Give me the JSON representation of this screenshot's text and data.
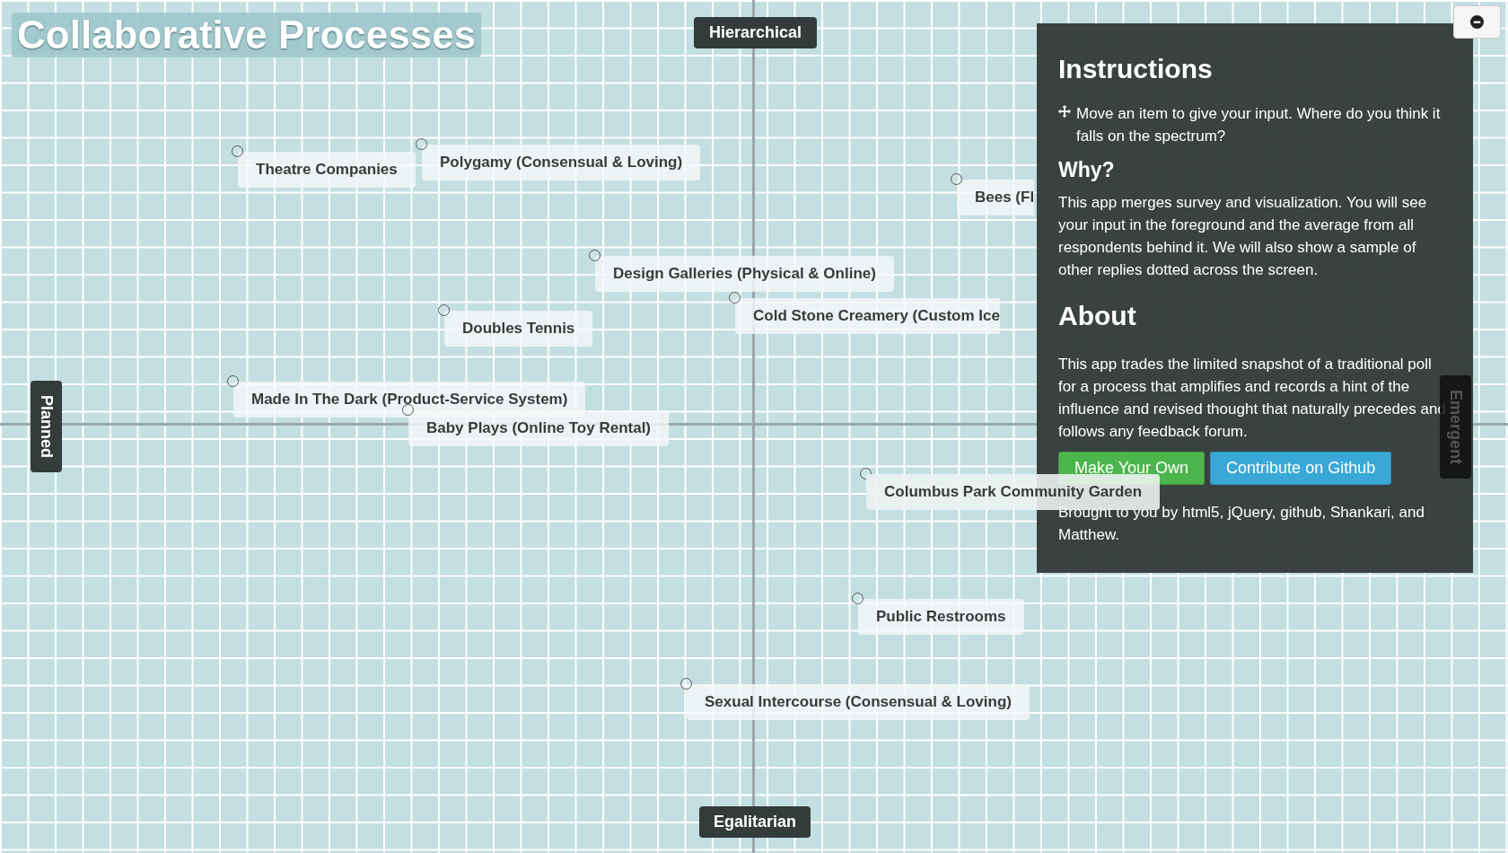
{
  "title": "Collaborative Processes",
  "axes": {
    "top": "Hierarchical",
    "bottom": "Egalitarian",
    "left": "Planned",
    "right": "Emergent"
  },
  "items": [
    {
      "label": "Theatre Companies"
    },
    {
      "label": "Polygamy (Consensual & Loving)"
    },
    {
      "label": "Bees (Fl",
      "clipped": true
    },
    {
      "label": "Design Galleries (Physical & Online)"
    },
    {
      "label": "Cold Stone Creamery (Custom Ice",
      "clipped": true
    },
    {
      "label": "Doubles Tennis"
    },
    {
      "label": "Made In The Dark (Product-Service System)"
    },
    {
      "label": "Baby Plays (Online Toy Rental)"
    },
    {
      "label": "Columbus Park Community Garden"
    },
    {
      "label": "Public Restrooms"
    },
    {
      "label": "Sexual Intercourse (Consensual & Loving)"
    }
  ],
  "panel": {
    "instructions_heading": "Instructions",
    "instructions_text": "Move an item to give your input. Where do you think it falls on the spectrum?",
    "why_heading": "Why?",
    "why_text": "This app merges survey and visualization. You will see your input in the foreground and the average from all respondents behind it. We will also show a sample of other replies dotted across the screen.",
    "about_heading": "About",
    "about_text": "This app trades the limited snapshot of a traditional poll for a process that amplifies and records a hint of the influence and revised thought that naturally precedes and follows any feedback forum.",
    "buttons": [
      {
        "label": "Make Your Own",
        "kind": "success"
      },
      {
        "label": "Contribute on Github",
        "kind": "info"
      }
    ],
    "credit": "Brought to you by html5, jQuery, github, Shankari, and Matthew."
  }
}
